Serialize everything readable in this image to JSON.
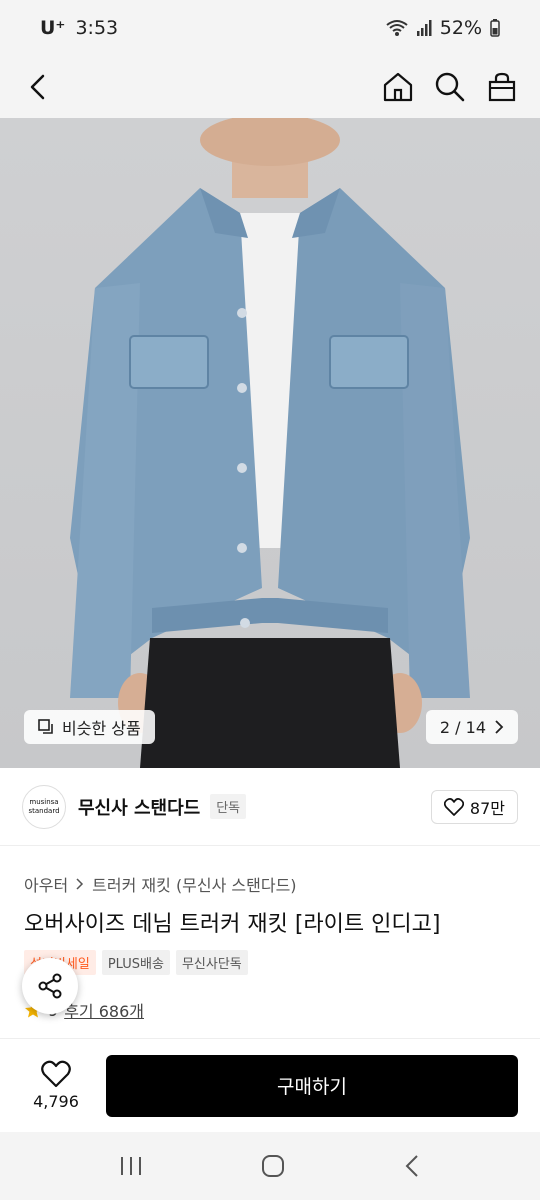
{
  "status_bar": {
    "carrier": "U⁺",
    "time": "3:53",
    "battery": "52%"
  },
  "nav": {
    "back_icon": "chevron-left-icon",
    "home_icon": "home-icon",
    "search_icon": "search-icon",
    "cart_icon": "shopping-bag-icon"
  },
  "hero": {
    "similar_label": "비슷한 상품",
    "counter": "2 / 14"
  },
  "brand": {
    "logo_line1": "musinsa",
    "logo_line2": "standard",
    "name": "무신사 스탠다드",
    "tag": "단독",
    "likes": "87만"
  },
  "breadcrumb": {
    "items": [
      "아우터",
      "트러커 재킷 (무신사 스탠다드)"
    ]
  },
  "product": {
    "title": "오버사이즈 데님 트러커 재킷 [라이트 인디고]",
    "badges": [
      "성녀비세일",
      "PLUS배송",
      "무신사단독"
    ],
    "rating_partial": "9",
    "reviews": "후기 686개"
  },
  "buy_bar": {
    "wish_count": "4,796",
    "buy_label": "구매하기"
  },
  "colors": {
    "accent_sale": "#ff5a1f",
    "buy_button": "#000000",
    "star": "#f5b400"
  }
}
